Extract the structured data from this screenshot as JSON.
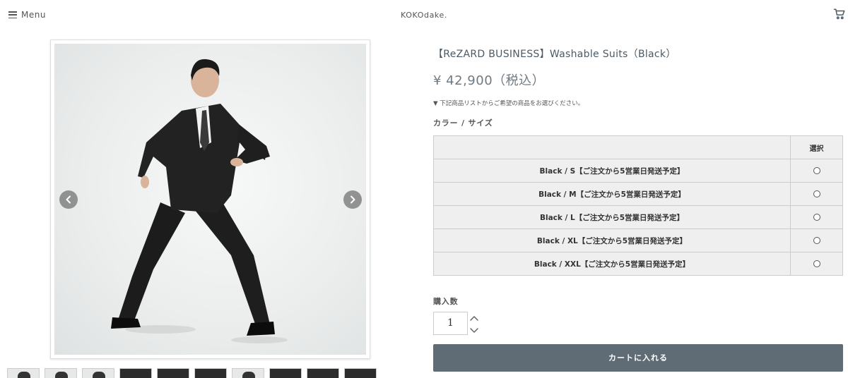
{
  "header": {
    "menu_label": "Menu",
    "logo": "KOKOdake."
  },
  "product": {
    "title": "【ReZARD BUSINESS】Washable Suits（Black）",
    "price": "¥ 42,900（税込）",
    "note": "▼ 下記商品リストからご希望の商品をお選びください。",
    "option_label": "カラー / サイズ",
    "select_header": "選択",
    "variants": [
      {
        "label": "Black / S【ご注文から5営業日発送予定】",
        "selected": false
      },
      {
        "label": "Black / M【ご注文から5営業日発送予定】",
        "selected": false
      },
      {
        "label": "Black / L【ご注文から5営業日発送予定】",
        "selected": false
      },
      {
        "label": "Black / XL【ご注文から5営業日発送予定】",
        "selected": false
      },
      {
        "label": "Black / XXL【ご注文から5営業日発送予定】",
        "selected": false
      }
    ],
    "quantity_label": "購入数",
    "quantity": "1",
    "add_to_cart": "カートに入れる"
  },
  "gallery": {
    "thumbnails": [
      "light",
      "light",
      "light",
      "dark",
      "dark",
      "dark",
      "light",
      "dark",
      "dark",
      "dark"
    ]
  },
  "colors": {
    "button": "#5f6c75",
    "title": "#4a5a66",
    "table_bg": "#efefef"
  }
}
